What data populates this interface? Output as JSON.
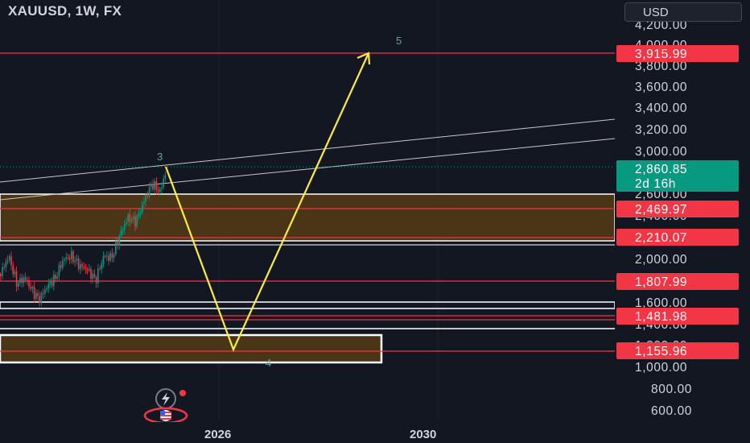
{
  "header": {
    "symbol": "XAUUSD, 1W, FX"
  },
  "toolbar": {
    "currency": "USD"
  },
  "price_axis": {
    "labels": [
      "4,200.00",
      "4,000.00",
      "3,800.00",
      "3,600.00",
      "3,400.00",
      "3,200.00",
      "3,000.00",
      "2,600.00",
      "2,400.00",
      "2,000.00",
      "1,600.00",
      "1,400.00",
      "1,200.00",
      "1,000.00",
      "800.00",
      "600.00"
    ]
  },
  "time_axis": {
    "labels": [
      "2026",
      "2030"
    ]
  },
  "price_tags": [
    {
      "text": "3,915.99",
      "color": "#f23645"
    },
    {
      "text": "2,469.97",
      "color": "#f23645"
    },
    {
      "text": "2,210.07",
      "color": "#f23645"
    },
    {
      "text": "1,807.99",
      "color": "#f23645"
    },
    {
      "text": "1,481.98",
      "color": "#f23645"
    },
    {
      "text": "1,155.96",
      "color": "#f23645"
    }
  ],
  "current_price": {
    "price": "2,860.85",
    "countdown": "2d 16h",
    "color": "#089981"
  },
  "wave_labels": [
    "3",
    "4",
    "5"
  ],
  "colors": {
    "background": "#131722",
    "zone_fill": "#4a3516",
    "zone_border": "#ffffff",
    "level_line": "#f23645",
    "projection": "#ffeb3b",
    "bull": "#089981",
    "bear": "#f23645"
  }
}
